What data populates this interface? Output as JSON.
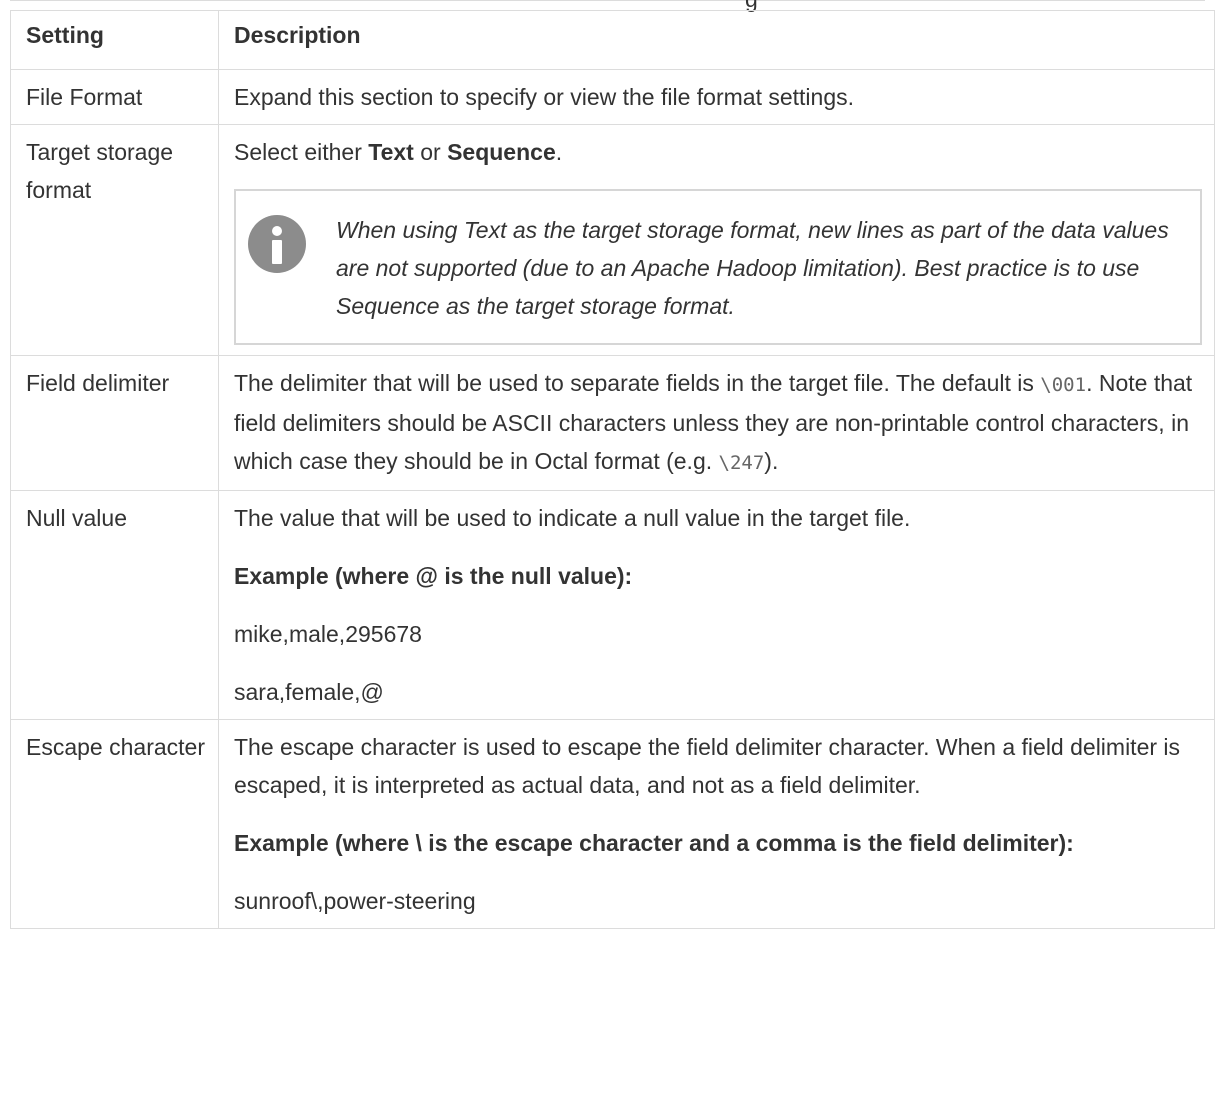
{
  "caption_fragment": "g",
  "table": {
    "headers": {
      "setting": "Setting",
      "description": "Description"
    },
    "rows": {
      "file_format": {
        "setting": "File Format",
        "description": "Expand this section to specify or view the file format settings."
      },
      "target_storage": {
        "setting": "Target storage format",
        "desc_prefix": "Select either ",
        "opt1": "Text",
        "desc_mid": " or ",
        "opt2": "Sequence",
        "desc_suffix": ".",
        "note_text": "When using Text as the target storage format, new lines as part of the data values are not supported (due to an Apache Hadoop limitation). Best practice is to use Sequence as the target storage format."
      },
      "field_delimiter": {
        "setting": "Field delimiter",
        "desc_part1": "The delimiter that will be used to separate fields in the target file. The default is ",
        "code1": "\\001",
        "desc_part2": ". Note that field delimiters should be ASCII characters unless they are non-printable control characters, in which case they should be in Octal format (e.g. ",
        "code2": "\\247",
        "desc_part3": ")."
      },
      "null_value": {
        "setting": "Null value",
        "description": "The value that will be used to indicate a null value in the target file.",
        "example_heading": "Example (where @ is the null value):",
        "example_line1": "mike,male,295678",
        "example_line2": "sara,female,@"
      },
      "escape_character": {
        "setting": "Escape character",
        "description": "The escape character is used to escape the field delimiter character. When a field delimiter is escaped, it is interpreted as actual data, and not as a field delimiter.",
        "example_heading": "Example (where \\ is the escape character and a comma is the field delimiter):",
        "example_line1": "sunroof\\,power-steering"
      }
    }
  }
}
